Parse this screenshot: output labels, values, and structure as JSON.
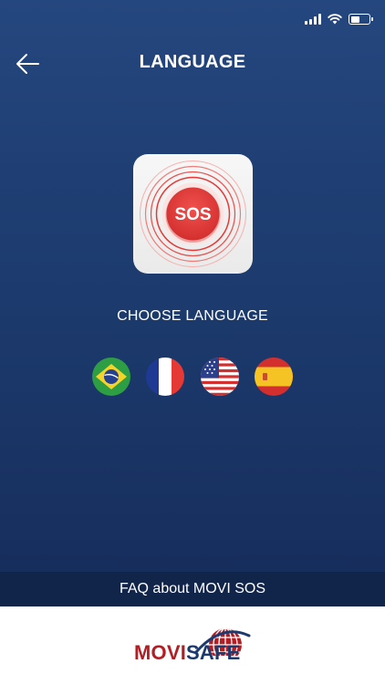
{
  "header": {
    "title": "LANGUAGE"
  },
  "app_icon": {
    "label": "SOS"
  },
  "language": {
    "prompt": "CHOOSE LANGUAGE"
  },
  "footer": {
    "faq_label": "FAQ about MOVI SOS",
    "logo_part_1": "MOVI",
    "logo_part_2": "SAFE"
  },
  "colors": {
    "background_top": "#25477f",
    "background_bottom": "#142954",
    "sos_red": "#e53935",
    "faq_bar": "#112449",
    "logo_red": "#b11e24",
    "logo_blue": "#1d3a6e"
  },
  "icons": {
    "back": "arrow-left-icon",
    "signal": "cellular-signal-icon",
    "wifi": "wifi-icon",
    "battery": "battery-icon"
  },
  "status": {
    "battery_level": 0.5
  }
}
